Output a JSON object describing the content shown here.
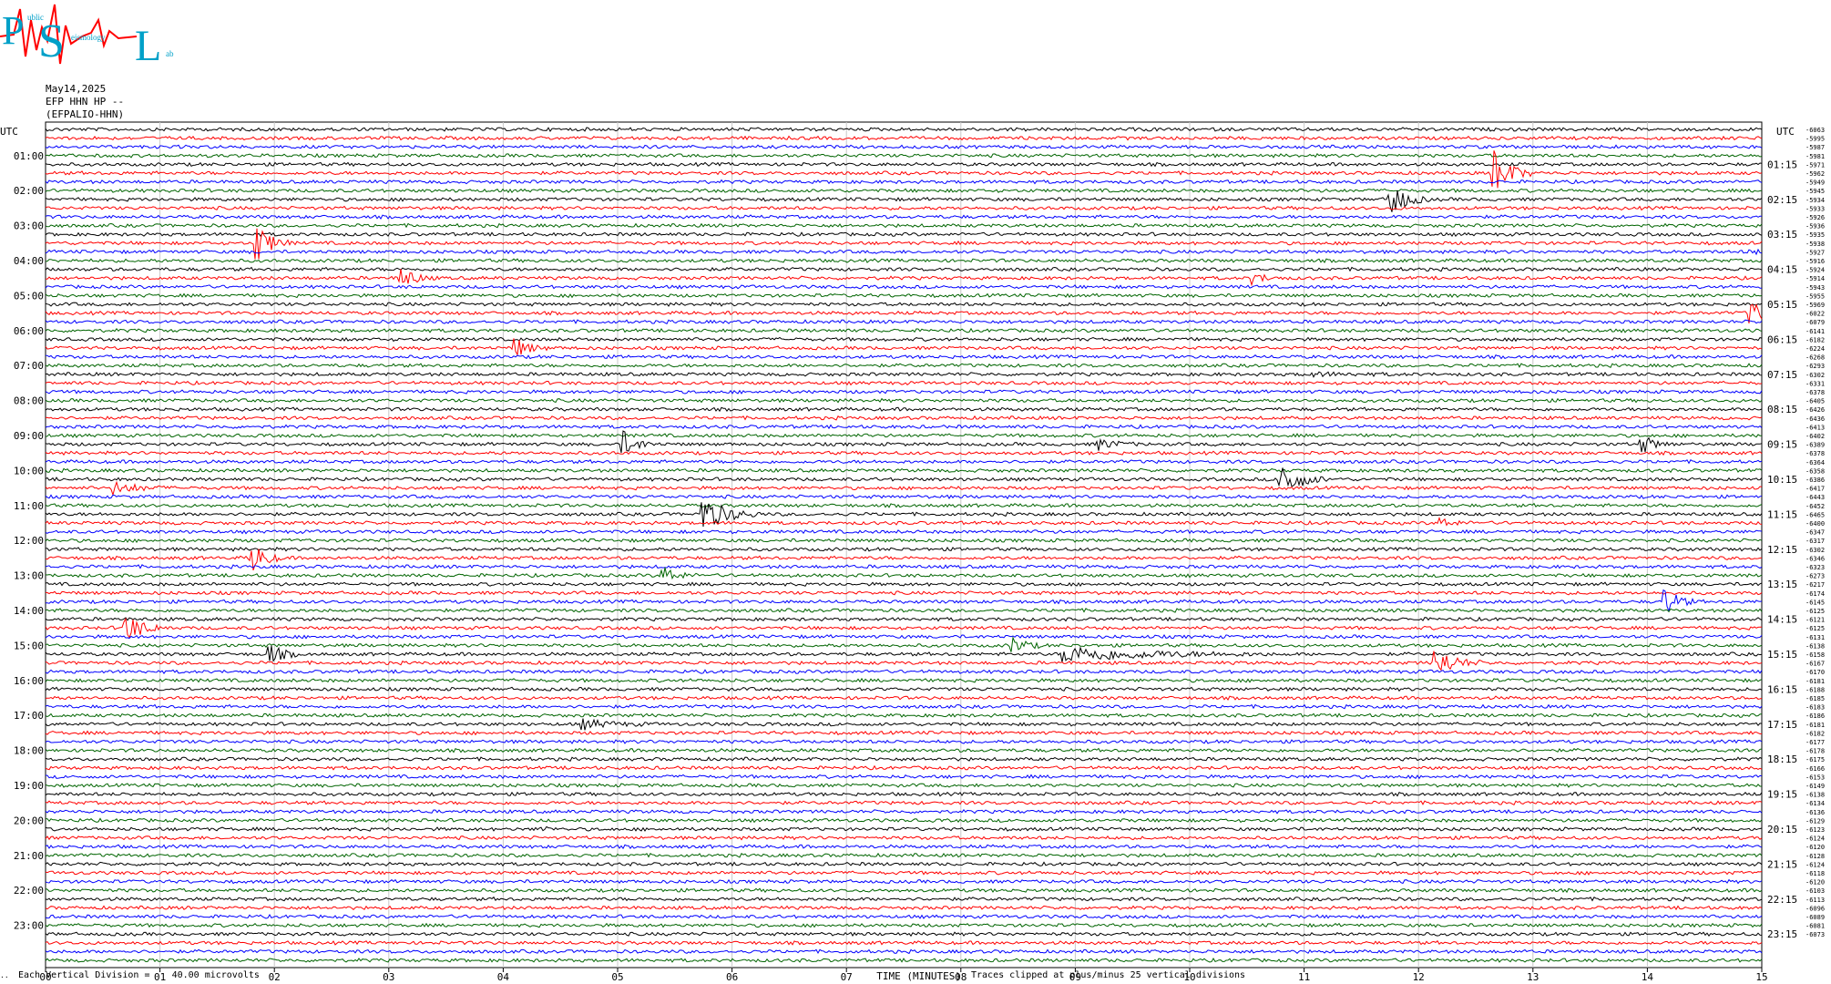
{
  "logo": {
    "letters": [
      "P",
      "S",
      "L"
    ],
    "small_words": [
      "ublic",
      "eismology",
      "ab"
    ]
  },
  "header": {
    "date": "May14,2025",
    "station": "EFP HHN HP --",
    "channel_id": "(EFPALIO-HHN)"
  },
  "chart_data": {
    "type": "line",
    "title": "",
    "left_axis_label": "UTC",
    "right_axis_label": "UTC",
    "left_labels": [
      "01:00",
      "02:00",
      "03:00",
      "04:00",
      "05:00",
      "06:00",
      "07:00",
      "08:00",
      "09:00",
      "10:00",
      "11:00",
      "12:00",
      "13:00",
      "14:00",
      "15:00",
      "16:00",
      "17:00",
      "18:00",
      "19:00",
      "20:00",
      "21:00",
      "22:00",
      "23:00"
    ],
    "right_labels": [
      "01:15",
      "02:15",
      "03:15",
      "04:15",
      "05:15",
      "06:15",
      "07:15",
      "08:15",
      "09:15",
      "10:15",
      "11:15",
      "12:15",
      "13:15",
      "14:15",
      "15:15",
      "16:15",
      "17:15",
      "18:15",
      "19:15",
      "20:15",
      "21:15",
      "22:15",
      "23:15"
    ],
    "x_ticks": [
      "00",
      "01",
      "02",
      "03",
      "04",
      "05",
      "06",
      "07",
      "08",
      "09",
      "10",
      "11",
      "12",
      "13",
      "14",
      "15"
    ],
    "xlabel": "TIME (MINUTES)",
    "trace_colors": [
      "#000000",
      "#ff0000",
      "#0000ff",
      "#006400"
    ],
    "trace_count": 96,
    "offsets": [
      "-6063",
      "-5995",
      "-5987",
      "-5981",
      "-5971",
      "-5962",
      "-5949",
      "-5945",
      "-5934",
      "-5933",
      "-5926",
      "-5936",
      "-5935",
      "-5938",
      "-5927",
      "-5916",
      "-5924",
      "-5914",
      "-5943",
      "-5955",
      "-5969",
      "-6022",
      "-6079",
      "-6141",
      "-6182",
      "-6224",
      "-6268",
      "-6293",
      "-6302",
      "-6331",
      "-6378",
      "-6405",
      "-6426",
      "-6436",
      "-6413",
      "-6402",
      "-6389",
      "-6378",
      "-6364",
      "-6358",
      "-6386",
      "-6417",
      "-6443",
      "-6452",
      "-6465",
      "-6400",
      "-6347",
      "-6317",
      "-6302",
      "-6346",
      "-6323",
      "-6273",
      "-6217",
      "-6174",
      "-6145",
      "-6125",
      "-6121",
      "-6125",
      "-6131",
      "-6138",
      "-6158",
      "-6167",
      "-6170",
      "-6181",
      "-6188",
      "-6185",
      "-6183",
      "-6186",
      "-6181",
      "-6182",
      "-6177",
      "-6178",
      "-6175",
      "-6166",
      "-6153",
      "-6149",
      "-6138",
      "-6134",
      "-6136",
      "-6129",
      "-6123",
      "-6124",
      "-6120",
      "-6128",
      "-6124",
      "-6118",
      "-6120",
      "-6103",
      "-6113",
      "-6096",
      "-6089",
      "-6081",
      "-6073"
    ],
    "events": [
      {
        "trace": 0,
        "minute": 9.65,
        "amp": 2,
        "dur": 0.05
      },
      {
        "trace": 5,
        "minute": 12.65,
        "amp": 30,
        "dur": 0.35
      },
      {
        "trace": 8,
        "minute": 11.75,
        "amp": 20,
        "dur": 0.35
      },
      {
        "trace": 13,
        "minute": 1.85,
        "amp": 22,
        "dur": 0.3
      },
      {
        "trace": 14,
        "minute": 14.9,
        "amp": 3,
        "dur": 0.2
      },
      {
        "trace": 17,
        "minute": 3.1,
        "amp": 14,
        "dur": 0.3
      },
      {
        "trace": 17,
        "minute": 10.55,
        "amp": 6,
        "dur": 0.3
      },
      {
        "trace": 21,
        "minute": 14.9,
        "amp": 14,
        "dur": 0.3
      },
      {
        "trace": 25,
        "minute": 4.1,
        "amp": 12,
        "dur": 0.3
      },
      {
        "trace": 28,
        "minute": 11.0,
        "amp": 2,
        "dur": 1.0
      },
      {
        "trace": 36,
        "minute": 5.05,
        "amp": 14,
        "dur": 0.3
      },
      {
        "trace": 36,
        "minute": 9.2,
        "amp": 6,
        "dur": 0.4
      },
      {
        "trace": 36,
        "minute": 13.95,
        "amp": 10,
        "dur": 0.3
      },
      {
        "trace": 40,
        "minute": 10.8,
        "amp": 22,
        "dur": 0.4
      },
      {
        "trace": 41,
        "minute": 0.6,
        "amp": 7,
        "dur": 0.5
      },
      {
        "trace": 44,
        "minute": 5.75,
        "amp": 20,
        "dur": 0.5
      },
      {
        "trace": 45,
        "minute": 12.2,
        "amp": 5,
        "dur": 0.3
      },
      {
        "trace": 49,
        "minute": 1.8,
        "amp": 18,
        "dur": 0.3
      },
      {
        "trace": 51,
        "minute": 5.4,
        "amp": 10,
        "dur": 0.3
      },
      {
        "trace": 54,
        "minute": 14.15,
        "amp": 16,
        "dur": 0.3
      },
      {
        "trace": 57,
        "minute": 0.7,
        "amp": 16,
        "dur": 0.4
      },
      {
        "trace": 59,
        "minute": 8.45,
        "amp": 10,
        "dur": 0.3
      },
      {
        "trace": 60,
        "minute": 1.95,
        "amp": 12,
        "dur": 0.3
      },
      {
        "trace": 60,
        "minute": 8.9,
        "amp": 9,
        "dur": 1.8
      },
      {
        "trace": 61,
        "minute": 12.15,
        "amp": 18,
        "dur": 0.4
      },
      {
        "trace": 68,
        "minute": 4.7,
        "amp": 5,
        "dur": 0.6
      },
      {
        "trace": 80,
        "minute": 4.35,
        "amp": 4,
        "dur": 0.1
      }
    ]
  },
  "footer": {
    "vertical_division": "Each Vertical Division =    40.00 microvolts",
    "clip_note": "Traces clipped at plus/minus 25 vertical divisions",
    "corner_mark": ".."
  }
}
